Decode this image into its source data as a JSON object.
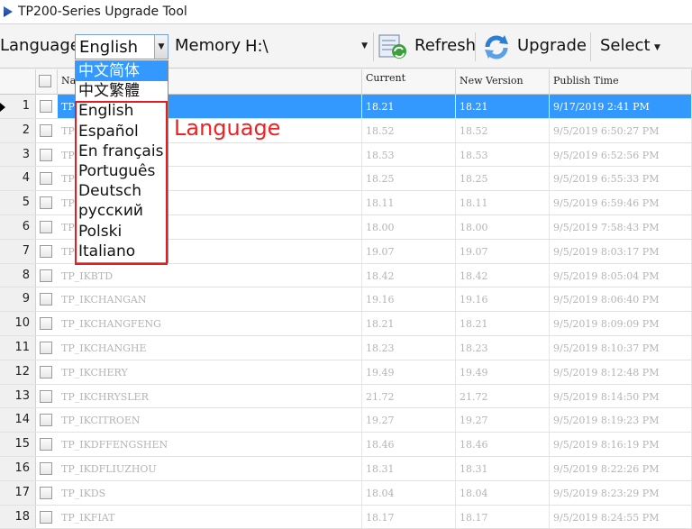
{
  "window": {
    "title": "TP200-Series Upgrade Tool"
  },
  "toolbar": {
    "language_label": "Language",
    "language_value": "English",
    "memory_label": "Memory",
    "memory_value": "H:\\",
    "refresh_label": "Refresh",
    "upgrade_label": "Upgrade",
    "select_label": "Select"
  },
  "dropdown": {
    "items": [
      "中文简体",
      "中文繁體",
      "English",
      "Español",
      "En français",
      "Português",
      "Deutsch",
      "русский",
      "Polski",
      "Italiano"
    ]
  },
  "annotation": {
    "text": "Language"
  },
  "table": {
    "headers": {
      "name": "Na",
      "current": "Current",
      "new_version": "New Version",
      "publish_time": "Publish Time"
    },
    "rows": [
      {
        "num": "1",
        "name": "TP",
        "current": "18.21",
        "new_version": "18.21",
        "publish_time": "9/17/2019 2:41 PM"
      },
      {
        "num": "2",
        "name": "TP",
        "current": "18.52",
        "new_version": "18.52",
        "publish_time": "9/5/2019 6:50:27 PM"
      },
      {
        "num": "3",
        "name": "TP",
        "current": "18.53",
        "new_version": "18.53",
        "publish_time": "9/5/2019 6:52:56 PM"
      },
      {
        "num": "4",
        "name": "TP",
        "current": "18.25",
        "new_version": "18.25",
        "publish_time": "9/5/2019 6:55:33 PM"
      },
      {
        "num": "5",
        "name": "TP",
        "current": "18.11",
        "new_version": "18.11",
        "publish_time": "9/5/2019 6:59:46 PM"
      },
      {
        "num": "6",
        "name": "TP",
        "current": "18.00",
        "new_version": "18.00",
        "publish_time": "9/5/2019 7:58:43 PM"
      },
      {
        "num": "7",
        "name": "TP",
        "current": "19.07",
        "new_version": "19.07",
        "publish_time": "9/5/2019 8:03:17 PM"
      },
      {
        "num": "8",
        "name": "TP_IKBTD",
        "current": "18.42",
        "new_version": "18.42",
        "publish_time": "9/5/2019 8:05:04 PM"
      },
      {
        "num": "9",
        "name": "TP_IKCHANGAN",
        "current": "19.16",
        "new_version": "19.16",
        "publish_time": "9/5/2019 8:06:40 PM"
      },
      {
        "num": "10",
        "name": "TP_IKCHANGFENG",
        "current": "18.21",
        "new_version": "18.21",
        "publish_time": "9/5/2019 8:09:09 PM"
      },
      {
        "num": "11",
        "name": "TP_IKCHANGHE",
        "current": "18.23",
        "new_version": "18.23",
        "publish_time": "9/5/2019 8:10:37 PM"
      },
      {
        "num": "12",
        "name": "TP_IKCHERY",
        "current": "19.49",
        "new_version": "19.49",
        "publish_time": "9/5/2019 8:12:48 PM"
      },
      {
        "num": "13",
        "name": "TP_IKCHRYSLER",
        "current": "21.72",
        "new_version": "21.72",
        "publish_time": "9/5/2019 8:14:50 PM"
      },
      {
        "num": "14",
        "name": "TP_IKCITROEN",
        "current": "19.27",
        "new_version": "19.27",
        "publish_time": "9/5/2019 8:19:23 PM"
      },
      {
        "num": "15",
        "name": "TP_IKDFFENGSHEN",
        "current": "18.46",
        "new_version": "18.46",
        "publish_time": "9/5/2019 8:16:19 PM"
      },
      {
        "num": "16",
        "name": "TP_IKDFLIUZHOU",
        "current": "18.31",
        "new_version": "18.31",
        "publish_time": "9/5/2019 8:22:26 PM"
      },
      {
        "num": "17",
        "name": "TP_IKDS",
        "current": "18.04",
        "new_version": "18.04",
        "publish_time": "9/5/2019 8:23:29 PM"
      },
      {
        "num": "18",
        "name": "TP_IKFIAT",
        "current": "18.17",
        "new_version": "18.17",
        "publish_time": "9/5/2019 8:24:55 PM"
      }
    ]
  },
  "colors": {
    "selection": "#3399ff",
    "annotation": "#ee2222"
  }
}
